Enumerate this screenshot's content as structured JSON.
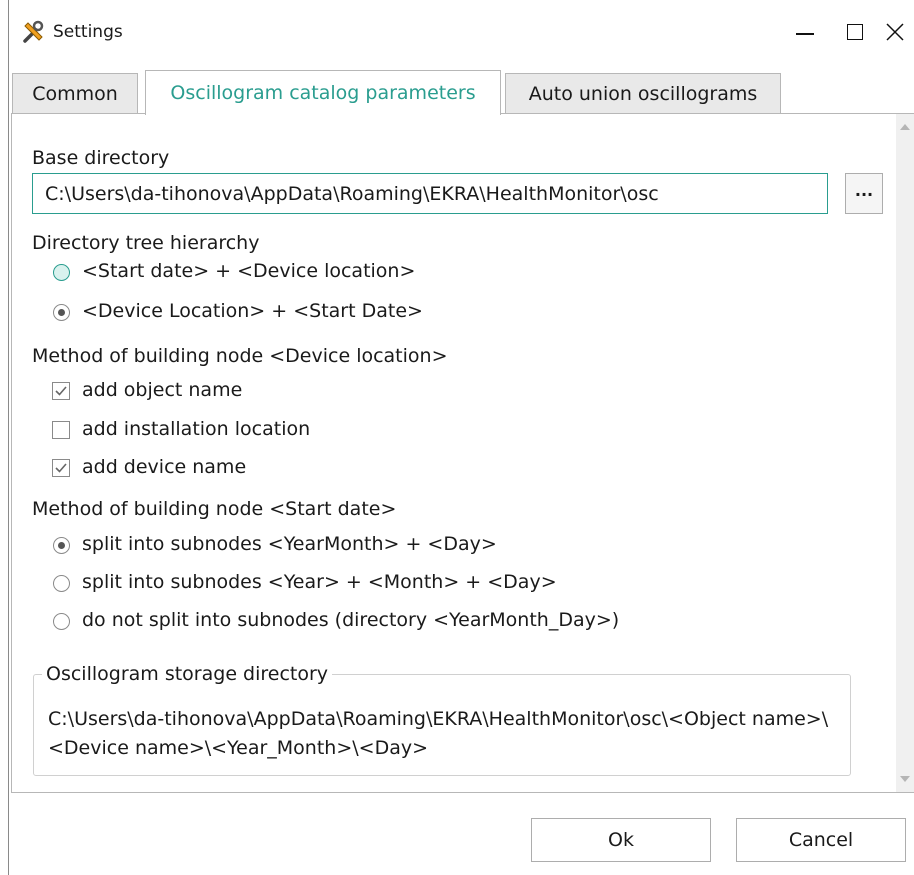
{
  "window": {
    "title": "Settings"
  },
  "tabs": [
    {
      "label": "Common"
    },
    {
      "label": "Oscillogram catalog parameters"
    },
    {
      "label": "Auto union oscillograms"
    }
  ],
  "base_directory": {
    "label": "Base directory",
    "value": "C:\\Users\\da-tihonova\\AppData\\Roaming\\EKRA\\HealthMonitor\\osc",
    "browse_label": "..."
  },
  "hierarchy": {
    "label": "Directory tree hierarchy",
    "options": [
      {
        "label": "<Start date> + <Device location>",
        "selected": false
      },
      {
        "label": "<Device Location> + <Start Date>",
        "selected": true
      }
    ]
  },
  "location_method": {
    "label": "Method of building node <Device location>",
    "options": [
      {
        "label": "add object name",
        "checked": true
      },
      {
        "label": "add installation location",
        "checked": false
      },
      {
        "label": "add device name",
        "checked": true
      }
    ]
  },
  "date_method": {
    "label": "Method of building node <Start date>",
    "options": [
      {
        "label": "split into subnodes <YearMonth> + <Day>",
        "selected": true
      },
      {
        "label": "split into subnodes <Year> + <Month> + <Day>",
        "selected": false
      },
      {
        "label": "do not split into subnodes (directory <YearMonth_Day>)",
        "selected": false
      }
    ]
  },
  "storage": {
    "title": "Oscillogram storage directory",
    "path": "C:\\Users\\da-tihonova\\AppData\\Roaming\\EKRA\\HealthMonitor\\osc\\<Object name>\\<Device name>\\<Year_Month>\\<Day>"
  },
  "buttons": {
    "ok": "Ok",
    "cancel": "Cancel"
  },
  "colors": {
    "accent": "#2a9d8f"
  }
}
